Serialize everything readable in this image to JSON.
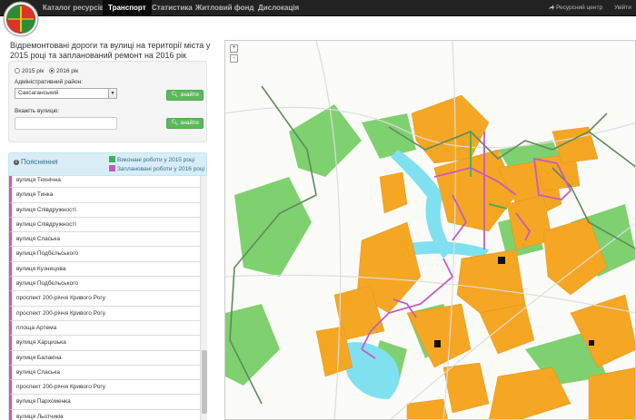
{
  "nav": {
    "items": [
      {
        "label": "Каталог ресурсів"
      },
      {
        "label": "Транспорт"
      },
      {
        "label": "Статистика"
      },
      {
        "label": "Житловий фонд"
      },
      {
        "label": "Дислокація"
      }
    ],
    "resource_center": "Ресурсний центр",
    "login": "Увійти"
  },
  "title": "Відремонтовані дороги та вулиці на території міста у 2015 році та запланований ремонт на 2016 рік",
  "form": {
    "year_2015": "2015 рік",
    "year_2016": "2016 рік",
    "selected_year": "2016 рік",
    "district_label": "Адміністративний район:",
    "district_value": "Саксаганський",
    "street_label": "Вкажіть вулицю:",
    "street_value": "",
    "find_label": "знайти"
  },
  "legend": {
    "title": "Пояснення",
    "done_label": "Виконані роботи у 2015 році",
    "planned_label": "Заплановані роботи у 2016 році",
    "done_color": "#3fae5d",
    "planned_color": "#c45ac6"
  },
  "streets": [
    "вулиця Технічна",
    "вулиця Тинка",
    "вулиця Співдружності",
    "вулиця Співдружності",
    "вулиця Спаська",
    "вулиця Подбєльського",
    "вулиця Кузнецова",
    "вулиця Подбєльського",
    "проспект 200-річчя Кривого Рогу",
    "проспект 200-річчя Кривого Рогу",
    "площа Артема",
    "вулиця Харцизька",
    "вулиця Балакіна",
    "вулиця Спаська",
    "проспект 200-річчя Кривого Рогу",
    "вулиця Пархоменка",
    "вулиця Льотчиків"
  ],
  "map": {
    "zoom_in": "+",
    "zoom_out": "−"
  }
}
